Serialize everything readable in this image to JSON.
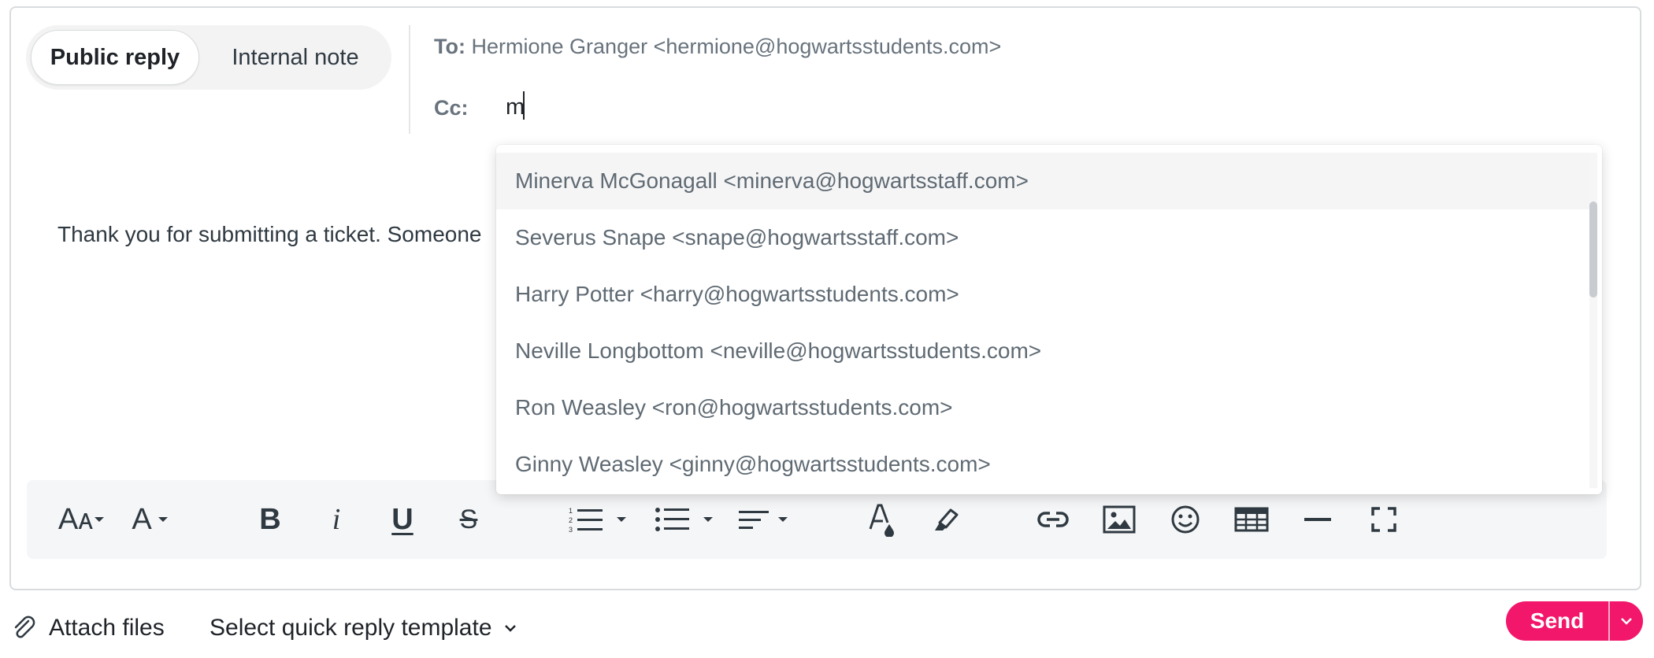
{
  "reply_mode": {
    "public_reply": "Public reply",
    "internal_note": "Internal note",
    "selected": "Public reply"
  },
  "recipients": {
    "to_label": "To:",
    "to_value": "Hermione Granger <hermione@hogwartsstudents.com>",
    "cc_label": "Cc:",
    "cc_value": "m"
  },
  "body": {
    "text": "Thank you for submitting a ticket. Someone"
  },
  "autocomplete": {
    "items": [
      "Minerva McGonagall <minerva@hogwartsstaff.com>",
      "Severus Snape <snape@hogwartsstaff.com>",
      "Harry Potter <harry@hogwartsstudents.com>",
      "Neville Longbottom <neville@hogwartsstudents.com>",
      "Ron Weasley <ron@hogwartsstudents.com>",
      "Ginny Weasley <ginny@hogwartsstudents.com>"
    ]
  },
  "toolbar": {
    "font_size_glyph": "Aᴀ",
    "font_glyph": "A",
    "bold_glyph": "B",
    "italic_glyph": "i",
    "underline_glyph": "U",
    "strikethrough_glyph": "S",
    "icons": [
      "font-size-icon",
      "font-icon",
      "bold-icon",
      "italic-icon",
      "underline-icon",
      "strikethrough-icon",
      "ordered-list-icon",
      "bullet-list-icon",
      "align-icon",
      "text-color-icon",
      "highlight-icon",
      "link-icon",
      "image-icon",
      "emoji-icon",
      "table-icon",
      "horizontal-rule-icon",
      "fullscreen-icon"
    ]
  },
  "footer": {
    "attach_label": "Attach files",
    "template_label": "Select quick reply template",
    "send_label": "Send"
  },
  "colors": {
    "accent": "#f2176b",
    "border": "#d8dcde",
    "text": "#2f3941",
    "muted": "#68737d",
    "toolbar_bg": "#f5f6f7"
  }
}
